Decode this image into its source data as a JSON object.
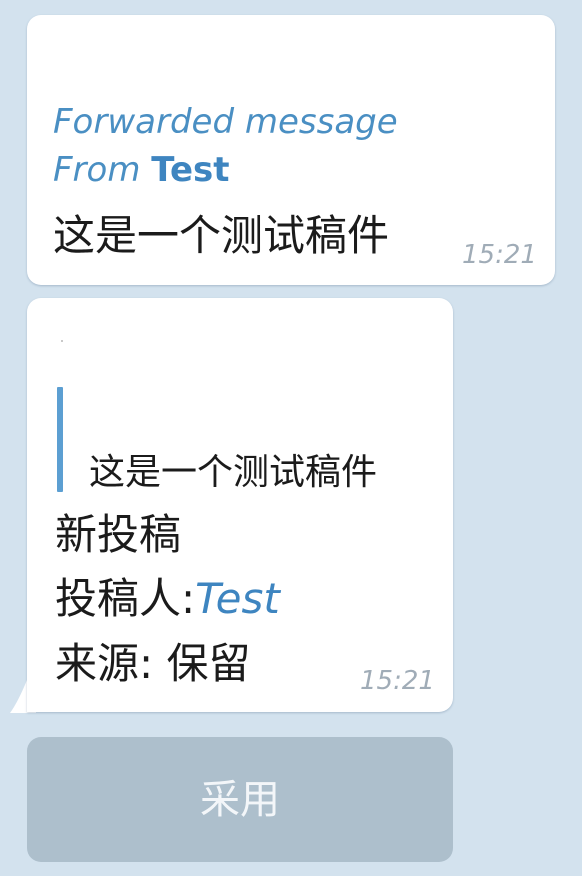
{
  "messages": [
    {
      "forward_header": "Forwarded message",
      "from_prefix": "From ",
      "from_name": "Test",
      "text": "这是一个测试稿件",
      "time": "15:21"
    },
    {
      "quote_text": "这是一个测试稿件",
      "title": "新投稿",
      "submitter_label": "投稿人:",
      "submitter_name": "Test",
      "source_line": "来源: 保留",
      "time": "15:21"
    }
  ],
  "action_button": {
    "label": "采用"
  },
  "colors": {
    "background": "#d3e2ee",
    "bubble": "#ffffff",
    "accent": "#3e85c0",
    "quote_bar": "#5c9fd2",
    "button": "#adbfcc",
    "timestamp": "#a0acb7"
  }
}
